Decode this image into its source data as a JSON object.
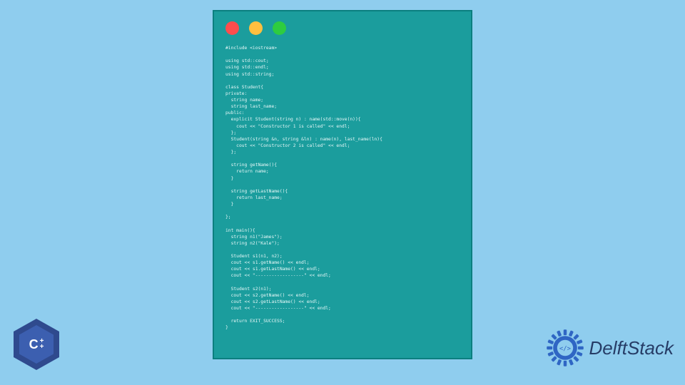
{
  "window": {
    "dots": [
      "red",
      "yellow",
      "green"
    ]
  },
  "code": "#include <iostream>\n\nusing std::cout;\nusing std::endl;\nusing std::string;\n\nclass Student{\nprivate:\n  string name;\n  string last_name;\npublic:\n  explicit Student(string n) : name(std::move(n)){\n    cout << \"Constructor 1 is called\" << endl;\n  };\n  Student(string &n, string &ln) : name(n), last_name(ln){\n    cout << \"Constructor 2 is called\" << endl;\n  };\n\n  string getName(){\n    return name;\n  }\n\n  string getLastName(){\n    return last_name;\n  }\n\n};\n\nint main(){\n  string n1(\"James\");\n  string n2(\"Kale\");\n\n  Student s1(n1, n2);\n  cout << s1.getName() << endl;\n  cout << s1.getLastName() << endl;\n  cout << \"------------------\" << endl;\n\n  Student s2(n1);\n  cout << s2.getName() << endl;\n  cout << s2.getLastName() << endl;\n  cout << \"------------------\" << endl;\n\n  return EXIT_SUCCESS;\n}",
  "cpp_badge": {
    "letter": "C",
    "plus": "++"
  },
  "brand": {
    "name": "DelftStack"
  }
}
